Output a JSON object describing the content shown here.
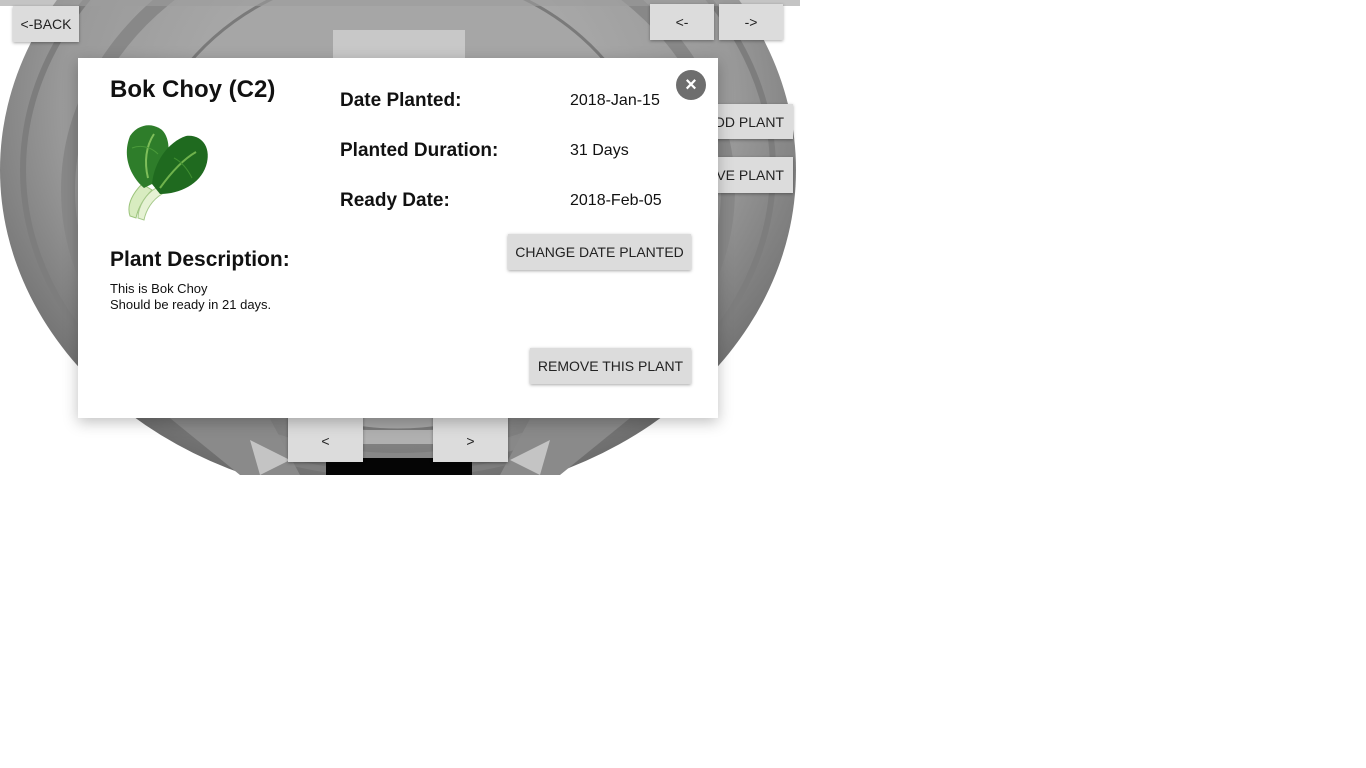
{
  "nav": {
    "back_label": "<-BACK",
    "prev_view_label": "<-",
    "next_view_label": "->",
    "add_plant_label": "DD PLANT",
    "remove_plant_label": "VE PLANT",
    "prev_row_label": "<",
    "next_row_label": ">"
  },
  "modal": {
    "title": "Bok Choy (C2)",
    "close_label": "×",
    "image_icon": "bok-choy-image",
    "fields": {
      "date_planted_label": "Date Planted:",
      "date_planted_value": "2018-Jan-15",
      "duration_label": "Planted Duration:",
      "duration_value": "31 Days",
      "ready_label": "Ready Date:",
      "ready_value": "2018-Feb-05"
    },
    "description_heading": "Plant Description:",
    "description_lines": [
      "This is Bok Choy",
      "Should be ready in 21 days."
    ],
    "change_date_label": "CHANGE DATE PLANTED",
    "remove_label": "REMOVE THIS PLANT"
  }
}
